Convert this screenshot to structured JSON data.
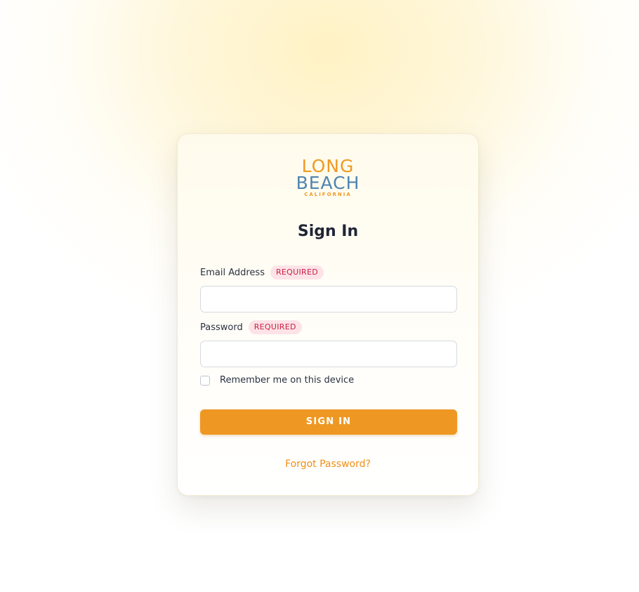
{
  "logo": {
    "line1": "LONG",
    "line2": "BEACH",
    "line3": "CALIFORNIA"
  },
  "form": {
    "title": "Sign In",
    "email": {
      "label": "Email Address",
      "badge": "REQUIRED",
      "value": "",
      "placeholder": ""
    },
    "password": {
      "label": "Password",
      "badge": "REQUIRED",
      "value": "",
      "placeholder": ""
    },
    "remember_label": "Remember me on this device",
    "remember_checked": false,
    "submit_label": "SIGN IN",
    "forgot_label": "Forgot Password?"
  },
  "colors": {
    "accent": "#ee9823",
    "logo_blue": "#4f84b0",
    "required_text": "#c81e42",
    "required_bg": "#fde3e7"
  }
}
